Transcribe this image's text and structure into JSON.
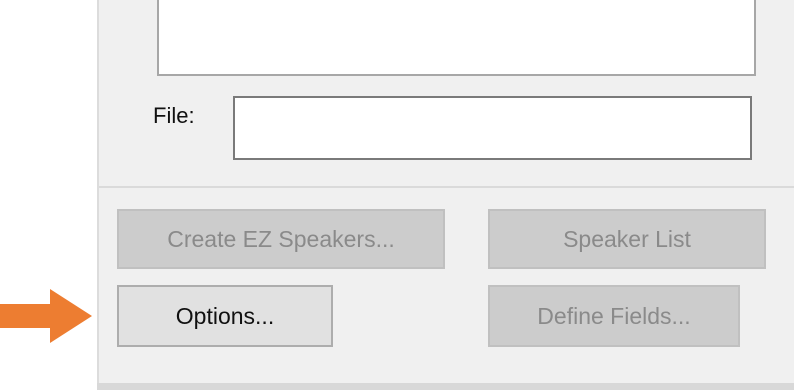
{
  "file_label": "File:",
  "file_value": "",
  "buttons": {
    "create_ez": "Create EZ Speakers...",
    "speaker_list": "Speaker List",
    "options": "Options...",
    "define_fields": "Define Fields..."
  },
  "arrow_color": "#ed7d31"
}
